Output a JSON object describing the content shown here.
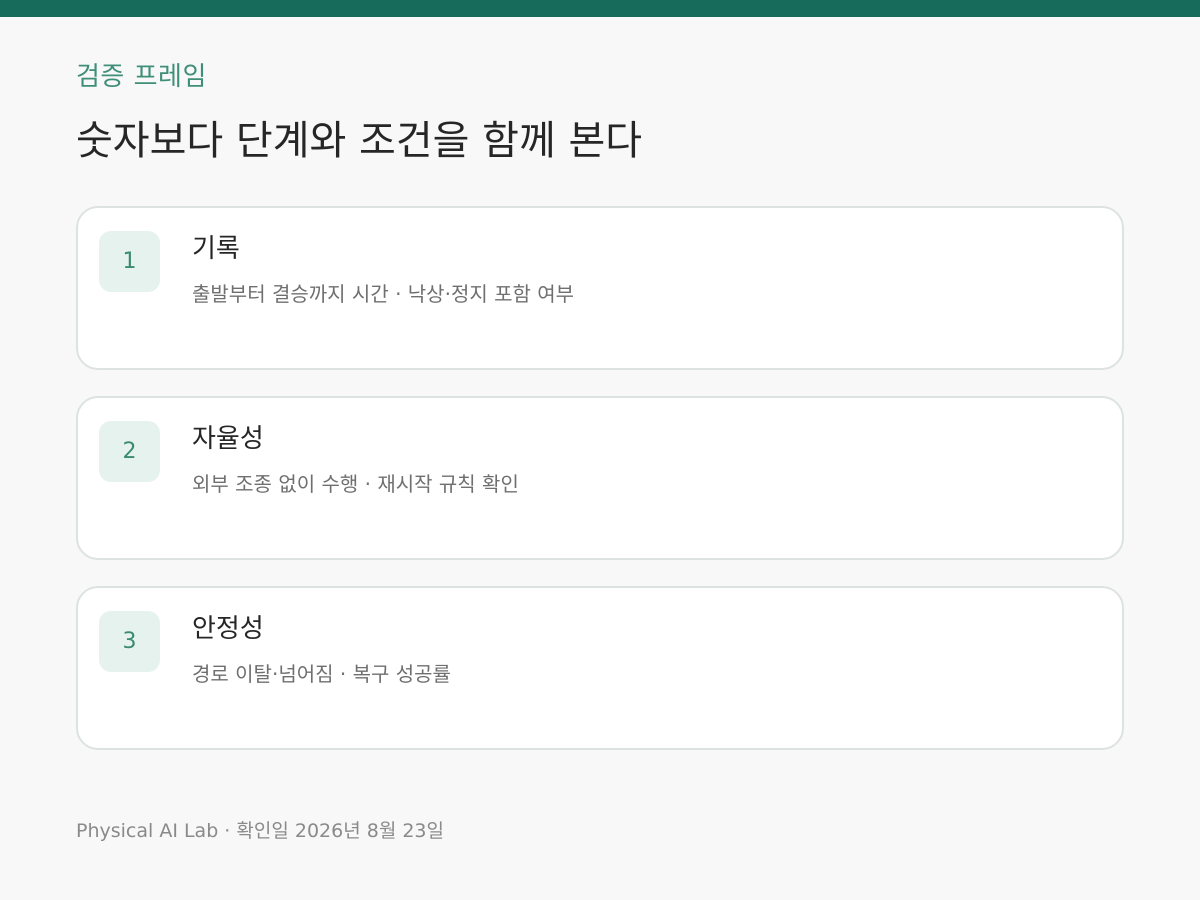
{
  "header": {
    "accent_color": "#176b5b",
    "eyebrow": "검증 프레임",
    "headline": "숫자보다 단계와 조건을 함께 본다"
  },
  "cards": [
    {
      "number": "1",
      "title": "기록",
      "description": "출발부터 결승까지 시간 · 낙상·정지 포함 여부"
    },
    {
      "number": "2",
      "title": "자율성",
      "description": "외부 조종 없이 수행 · 재시작 규칙 확인"
    },
    {
      "number": "3",
      "title": "안정성",
      "description": "경로 이탈·넘어짐 · 복구 성공률"
    }
  ],
  "footer": {
    "text": "Physical AI Lab · 확인일 2026년 8월 23일"
  }
}
